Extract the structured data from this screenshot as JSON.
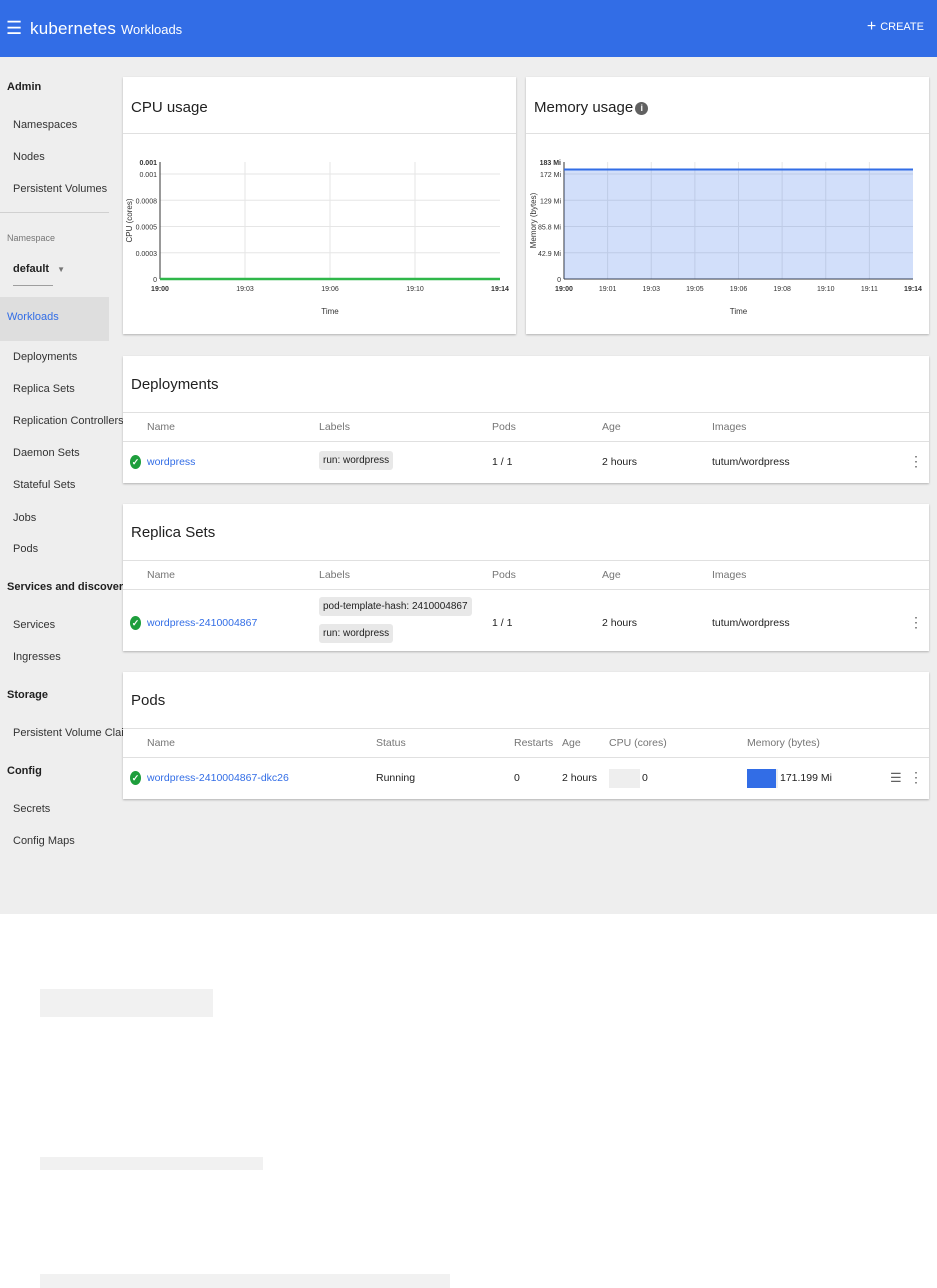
{
  "topbar": {
    "menu_icon": "☰",
    "brand": "kubernetes",
    "breadcrumb": "Workloads",
    "create_label": "CREATE",
    "create_icon": "+"
  },
  "sidebar": {
    "admin": "Admin",
    "namespaces": "Namespaces",
    "nodes": "Nodes",
    "persistent_volumes": "Persistent Volumes",
    "namespace_label": "Namespace",
    "namespace_value": "default",
    "namespace_caret": "▼",
    "workloads": "Workloads",
    "deployments": "Deployments",
    "replica_sets": "Replica Sets",
    "replication_controllers": "Replication Controllers",
    "daemon_sets": "Daemon Sets",
    "stateful_sets": "Stateful Sets",
    "jobs": "Jobs",
    "pods": "Pods",
    "services_discovery": "Services and discovery",
    "services": "Services",
    "ingresses": "Ingresses",
    "storage": "Storage",
    "pvc": "Persistent Volume Claims",
    "config": "Config",
    "secrets": "Secrets",
    "config_maps": "Config Maps"
  },
  "cpu_card": {
    "title": "CPU usage"
  },
  "memory_card": {
    "title": "Memory usage",
    "info_icon": "i"
  },
  "chart_data": [
    {
      "type": "line",
      "title": "CPU usage",
      "xlabel": "Time",
      "ylabel": "CPU (cores)",
      "x_ticks": [
        "19:00",
        "19:03",
        "19:06",
        "19:10",
        "19:14"
      ],
      "y_ticks": [
        "0",
        "0.0003",
        "0.0005",
        "0.0008",
        "0.001"
      ],
      "y_max_label": "0.001",
      "ylim": [
        0,
        0.001
      ],
      "series": [
        {
          "values": [
            0,
            0,
            0,
            0,
            0
          ],
          "color": "#2fb74a"
        }
      ],
      "grid": true
    },
    {
      "type": "area",
      "title": "Memory usage",
      "xlabel": "Time",
      "ylabel": "Memory (bytes)",
      "x_ticks": [
        "19:00",
        "19:01",
        "19:03",
        "19:05",
        "19:06",
        "19:08",
        "19:10",
        "19:11",
        "19:14"
      ],
      "y_ticks": [
        "0",
        "42.9 Mi",
        "85.8 Mi",
        "129 Mi",
        "172 Mi"
      ],
      "y_max_label": "183 Mi",
      "ylim": [
        0,
        183
      ],
      "series": [
        {
          "values": [
            171.199,
            171.199,
            171.199,
            171.199,
            171.199,
            171.199,
            171.199,
            171.199,
            171.199
          ],
          "color": "#326de6"
        }
      ],
      "grid": true
    }
  ],
  "deployments": {
    "title": "Deployments",
    "headers": {
      "name": "Name",
      "labels": "Labels",
      "pods": "Pods",
      "age": "Age",
      "images": "Images"
    },
    "row": {
      "name": "wordpress",
      "label": "run: wordpress",
      "pods": "1 / 1",
      "age": "2 hours",
      "images": "tutum/wordpress"
    }
  },
  "replica_sets": {
    "title": "Replica Sets",
    "headers": {
      "name": "Name",
      "labels": "Labels",
      "pods": "Pods",
      "age": "Age",
      "images": "Images"
    },
    "row": {
      "name": "wordpress-2410004867",
      "label1": "pod-template-hash: 2410004867",
      "label2": "run: wordpress",
      "pods": "1 / 1",
      "age": "2 hours",
      "images": "tutum/wordpress"
    }
  },
  "pods": {
    "title": "Pods",
    "headers": {
      "name": "Name",
      "status": "Status",
      "restarts": "Restarts",
      "age": "Age",
      "cpu": "CPU (cores)",
      "memory": "Memory (bytes)"
    },
    "row": {
      "name": "wordpress-2410004867-dkc26",
      "status": "Running",
      "restarts": "0",
      "age": "2 hours",
      "cpu": "0",
      "memory": "171.199 Mi",
      "memory_fraction": 0.94,
      "cpu_fraction": 0
    }
  },
  "icons": {
    "check": "check-circle-icon",
    "kebab": "more-vert-icon",
    "logs": "logs-icon"
  }
}
